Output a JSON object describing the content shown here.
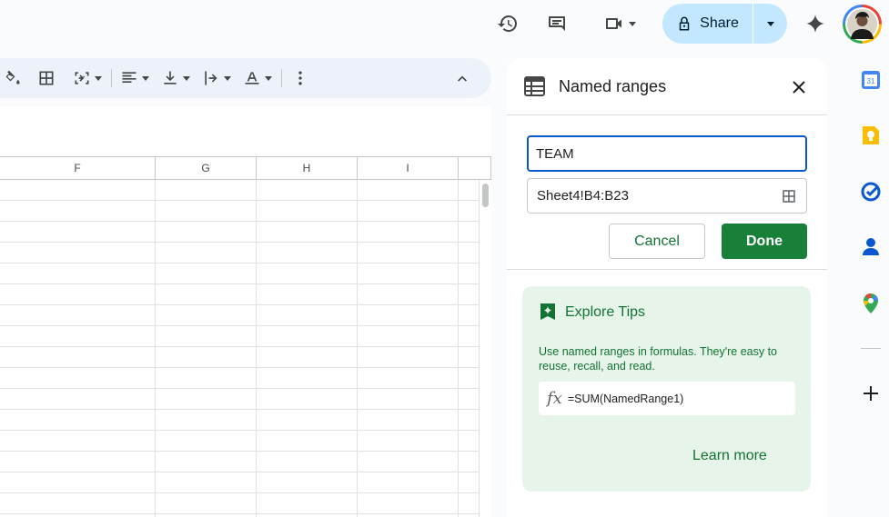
{
  "topbar": {
    "share_label": "Share",
    "icons": [
      "history-icon",
      "comment-icon",
      "video-call-icon",
      "lock-icon",
      "gemini-icon",
      "avatar"
    ]
  },
  "toolbar": {
    "icons": [
      "fill-color-icon",
      "borders-icon",
      "merge-cells-icon",
      "horizontal-align-icon",
      "vertical-align-icon",
      "text-wrap-icon",
      "text-rotation-icon",
      "more-options-icon",
      "collapse-icon"
    ]
  },
  "sheet": {
    "columns": [
      "F",
      "G",
      "H",
      "I"
    ]
  },
  "panel": {
    "title": "Named ranges",
    "name_value": "TEAM",
    "range_value": "Sheet4!B4:B23",
    "cancel_label": "Cancel",
    "done_label": "Done",
    "tips": {
      "title": "Explore Tips",
      "body": "Use named ranges in formulas. They're easy to reuse, recall, and read.",
      "fx": "fx",
      "formula": "=SUM(NamedRange1)",
      "learn_more": "Learn more"
    }
  },
  "side_rail": {
    "apps": [
      "calendar-icon",
      "keep-icon",
      "tasks-icon",
      "contacts-icon",
      "maps-icon",
      "add-icon"
    ]
  },
  "colors": {
    "accent_green": "#188038",
    "tips_bg": "#e6f4ea",
    "share_bg": "#c2e7ff",
    "focus_blue": "#0b57d0"
  }
}
